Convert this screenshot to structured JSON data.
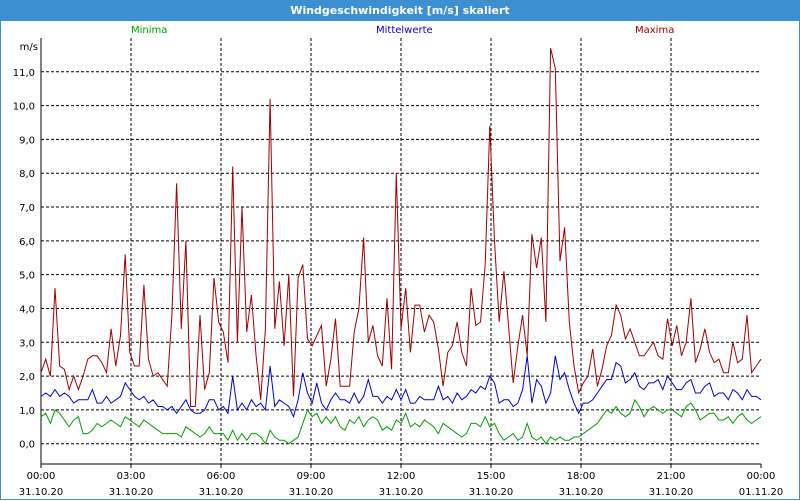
{
  "window": {
    "title": "Windgeschwindigkeit [m/s] skaliert"
  },
  "colors": {
    "title_bg": "#3c8fd0",
    "min": "#00a000",
    "mean": "#0000c8",
    "max": "#a00000",
    "grid": "#000000"
  },
  "legend": {
    "min_label": "Minima",
    "mean_label": "Mittelwerte",
    "max_label": "Maxima"
  },
  "chart_data": {
    "type": "line",
    "ylabel": "m/s",
    "ylim": [
      -0.6,
      12.0
    ],
    "yticks": [
      "0,0",
      "1,0",
      "2,0",
      "3,0",
      "4,0",
      "5,0",
      "6,0",
      "7,0",
      "8,0",
      "9,0",
      "10,0",
      "11,0"
    ],
    "xlim": [
      0,
      24
    ],
    "grid": true,
    "legend_position": "top",
    "x_ticks": [
      {
        "time": "00:00",
        "date": "31.10.20"
      },
      {
        "time": "03:00",
        "date": "31.10.20"
      },
      {
        "time": "06:00",
        "date": "31.10.20"
      },
      {
        "time": "09:00",
        "date": "31.10.20"
      },
      {
        "time": "12:00",
        "date": "31.10.20"
      },
      {
        "time": "15:00",
        "date": "31.10.20"
      },
      {
        "time": "18:00",
        "date": "31.10.20"
      },
      {
        "time": "21:00",
        "date": "31.10.20"
      },
      {
        "time": "00:00",
        "date": "01.11.20"
      }
    ],
    "x_interval_hours": 0.1667,
    "series": [
      {
        "name": "Maxima",
        "values": [
          2.1,
          2.5,
          2.0,
          4.6,
          2.3,
          2.2,
          1.6,
          2.0,
          1.6,
          2.0,
          2.5,
          2.6,
          2.6,
          2.4,
          2.1,
          3.4,
          2.3,
          3.2,
          5.6,
          2.7,
          2.3,
          2.3,
          4.7,
          2.5,
          2.0,
          2.1,
          1.9,
          1.7,
          3.8,
          7.7,
          3.4,
          6.0,
          1.1,
          1.1,
          3.8,
          1.6,
          2.1,
          4.9,
          3.6,
          3.3,
          2.4,
          8.2,
          3.0,
          7.0,
          3.3,
          4.4,
          2.6,
          1.3,
          3.4,
          10.2,
          3.4,
          4.8,
          2.9,
          5.0,
          1.4,
          4.9,
          5.3,
          3.1,
          2.9,
          3.2,
          3.5,
          1.7,
          2.5,
          3.7,
          1.7,
          1.7,
          1.7,
          3.3,
          4.0,
          6.1,
          3.0,
          3.5,
          2.6,
          2.3,
          4.3,
          2.2,
          8.0,
          3.4,
          4.6,
          2.7,
          4.1,
          4.1,
          3.3,
          3.8,
          3.6,
          2.8,
          1.7,
          2.7,
          2.9,
          3.6,
          2.7,
          2.3,
          4.6,
          3.5,
          3.6,
          5.3,
          9.4,
          6.0,
          3.6,
          5.1,
          3.5,
          1.8,
          2.9,
          3.8,
          2.6,
          6.2,
          5.2,
          6.1,
          3.6,
          11.7,
          11.1,
          5.4,
          6.4,
          3.6,
          2.3,
          1.5,
          1.8,
          2.0,
          2.8,
          1.7,
          2.2,
          2.9,
          3.2,
          4.1,
          3.8,
          3.1,
          3.4,
          3.0,
          2.6,
          2.6,
          2.8,
          3.0,
          2.6,
          2.5,
          3.7,
          2.9,
          3.5,
          2.6,
          3.0,
          4.3,
          2.4,
          2.8,
          3.4,
          2.7,
          2.4,
          2.5,
          2.1,
          2.1,
          3.0,
          2.4,
          2.5,
          3.8,
          2.1,
          2.3,
          2.5
        ]
      },
      {
        "name": "Mittelwerte",
        "values": [
          1.4,
          1.5,
          1.4,
          1.6,
          1.4,
          1.5,
          1.4,
          1.2,
          1.3,
          1.3,
          1.3,
          1.6,
          1.2,
          1.2,
          1.4,
          1.2,
          1.3,
          1.4,
          1.8,
          1.6,
          1.4,
          1.3,
          1.4,
          1.2,
          1.3,
          1.1,
          1.1,
          1.0,
          1.1,
          0.9,
          1.1,
          1.3,
          1.0,
          0.9,
          0.9,
          1.0,
          1.3,
          1.3,
          1.0,
          1.1,
          0.9,
          2.0,
          1.0,
          1.2,
          1.0,
          1.3,
          1.1,
          1.2,
          1.0,
          2.3,
          1.1,
          1.3,
          1.2,
          1.1,
          0.8,
          1.3,
          2.1,
          1.5,
          1.2,
          1.8,
          1.2,
          1.0,
          1.3,
          1.5,
          1.3,
          1.3,
          1.2,
          1.5,
          1.2,
          1.4,
          1.9,
          1.4,
          1.4,
          1.2,
          1.4,
          1.3,
          1.6,
          1.3,
          1.6,
          1.2,
          1.2,
          1.4,
          1.3,
          1.3,
          1.3,
          1.7,
          1.3,
          1.4,
          1.2,
          1.5,
          1.3,
          1.4,
          1.6,
          1.5,
          1.7,
          1.6,
          2.0,
          1.8,
          1.2,
          1.3,
          1.3,
          1.1,
          1.2,
          1.6,
          2.6,
          1.2,
          1.9,
          1.7,
          1.2,
          1.5,
          2.6,
          1.9,
          2.1,
          1.6,
          1.2,
          0.9,
          1.2,
          1.2,
          1.3,
          1.5,
          1.7,
          1.9,
          1.9,
          2.4,
          2.3,
          1.8,
          1.9,
          2.1,
          1.7,
          1.6,
          1.8,
          1.8,
          1.9,
          1.6,
          2.0,
          1.8,
          1.6,
          1.6,
          1.8,
          1.9,
          1.5,
          1.5,
          1.7,
          1.8,
          1.4,
          1.5,
          1.5,
          1.3,
          1.6,
          1.5,
          1.3,
          1.6,
          1.4,
          1.4,
          1.3
        ]
      },
      {
        "name": "Minima",
        "values": [
          0.8,
          0.9,
          0.6,
          1.0,
          0.9,
          0.7,
          0.5,
          0.7,
          0.8,
          0.3,
          0.3,
          0.4,
          0.6,
          0.5,
          0.6,
          0.7,
          0.6,
          0.5,
          0.8,
          0.7,
          0.6,
          0.5,
          0.7,
          0.6,
          0.5,
          0.4,
          0.3,
          0.3,
          0.3,
          0.3,
          0.2,
          0.5,
          0.4,
          0.3,
          0.2,
          0.3,
          0.5,
          0.3,
          0.3,
          0.3,
          0.1,
          0.4,
          0.1,
          0.3,
          0.1,
          0.3,
          0.3,
          0.2,
          0.0,
          0.4,
          0.2,
          0.1,
          0.1,
          0.0,
          0.1,
          0.2,
          0.6,
          1.0,
          0.8,
          0.9,
          0.6,
          0.8,
          0.6,
          0.8,
          0.5,
          0.4,
          0.7,
          0.6,
          0.8,
          0.5,
          0.7,
          0.8,
          0.7,
          0.4,
          0.5,
          0.4,
          0.7,
          0.6,
          0.9,
          0.5,
          0.6,
          0.5,
          0.7,
          0.6,
          0.5,
          0.3,
          0.6,
          0.5,
          0.4,
          0.3,
          0.2,
          0.3,
          0.6,
          0.6,
          0.5,
          0.8,
          0.5,
          0.6,
          0.3,
          0.1,
          0.2,
          0.3,
          0.1,
          0.2,
          0.6,
          0.2,
          0.1,
          0.2,
          0.0,
          0.2,
          0.1,
          0.2,
          0.1,
          0.1,
          0.2,
          0.2,
          0.3,
          0.4,
          0.5,
          0.6,
          0.8,
          1.0,
          0.9,
          1.1,
          0.9,
          0.8,
          0.9,
          1.3,
          1.1,
          0.8,
          1.0,
          1.1,
          1.0,
          0.9,
          1.0,
          1.0,
          0.9,
          0.8,
          1.1,
          1.2,
          1.0,
          0.7,
          0.8,
          0.9,
          0.9,
          0.7,
          0.7,
          0.8,
          0.6,
          0.8,
          0.9,
          0.7,
          0.6,
          0.7,
          0.8
        ]
      }
    ]
  }
}
